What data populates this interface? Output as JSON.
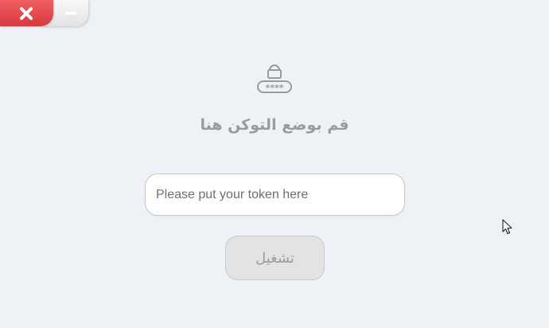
{
  "window": {
    "close_icon": "close-icon",
    "minimize_icon": "minimize-icon",
    "close_color": "#e14b4f"
  },
  "main": {
    "icon": "lock-password-icon",
    "icon_text": "****",
    "title": "قم بوضع التوكن هنا",
    "token_input": {
      "value": "",
      "placeholder": "Please put your token here"
    },
    "run_button_label": "تشغيل"
  },
  "colors": {
    "background": "#eef1f5",
    "text_muted": "#9b9b9b"
  }
}
